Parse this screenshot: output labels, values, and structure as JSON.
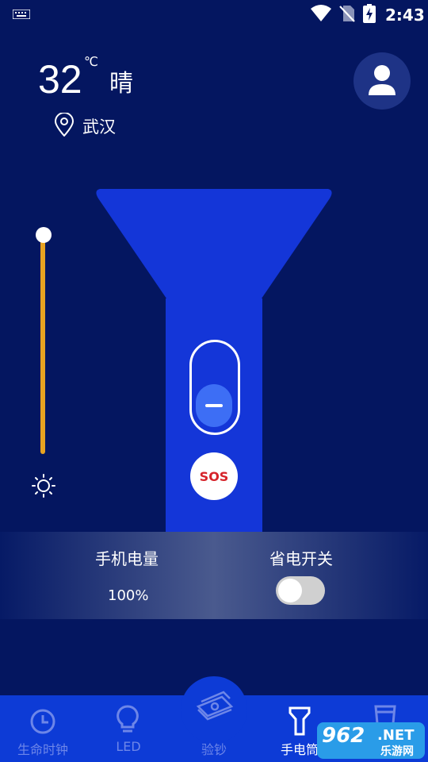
{
  "status_bar": {
    "time": "2:43"
  },
  "weather": {
    "temperature": "32",
    "unit": "℃",
    "condition": "晴",
    "city": "武汉"
  },
  "brightness": {
    "level": 1.0
  },
  "flashlight": {
    "sos_label": "SOS"
  },
  "info": {
    "battery_label": "手机电量",
    "battery_value": "100%",
    "power_save_label": "省电开关",
    "power_save_on": false
  },
  "bottom_nav": [
    {
      "label": "生命时钟",
      "icon": "clock-icon"
    },
    {
      "label": "LED",
      "icon": "bulb-icon"
    },
    {
      "label": "验钞",
      "icon": "banknote-icon"
    },
    {
      "label": "手电筒",
      "icon": "flashlight-icon",
      "active": true
    },
    {
      "label": "",
      "icon": "cup-icon"
    }
  ],
  "watermark": {
    "big": "962",
    "net": ".NET",
    "sub": "乐游网"
  },
  "colors": {
    "background": "#041660",
    "torch": "#1436d8",
    "accent": "#e8a321",
    "nav": "#0d3bd6",
    "sos_text": "#d6232a"
  }
}
